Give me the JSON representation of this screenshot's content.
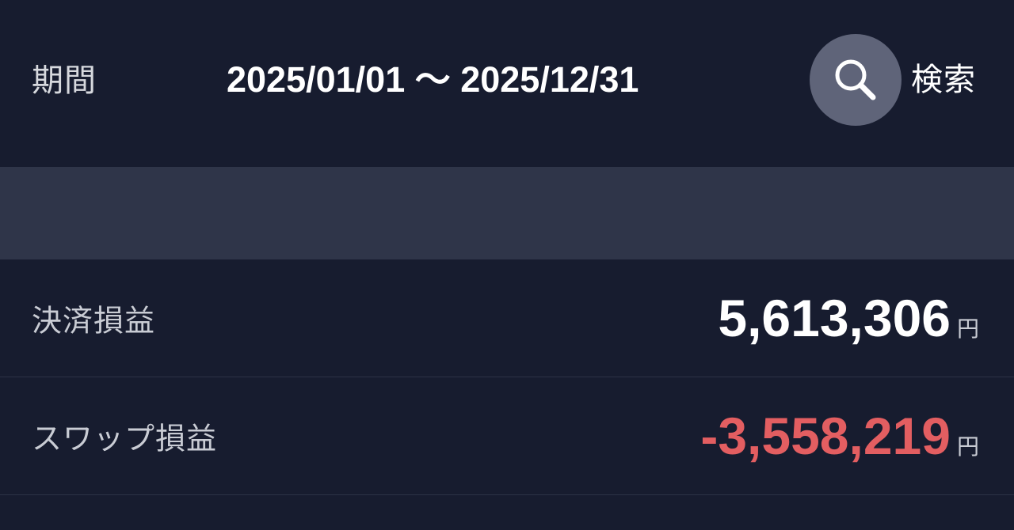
{
  "header": {
    "period_label": "期間",
    "period_range": "2025/01/01 〜 2025/12/31",
    "search_label": "検索",
    "search_icon": "search-icon"
  },
  "rows": [
    {
      "label": "決済損益",
      "amount": "5,613,306",
      "unit": "円",
      "sign": "positive",
      "color": "#ffffff"
    },
    {
      "label": "スワップ損益",
      "amount": "-3,558,219",
      "unit": "円",
      "sign": "negative",
      "color": "#e35e61"
    }
  ],
  "colors": {
    "background": "#171c2f",
    "band": "#2f3549",
    "negative": "#e35e61",
    "search_button": "#5f6479"
  }
}
